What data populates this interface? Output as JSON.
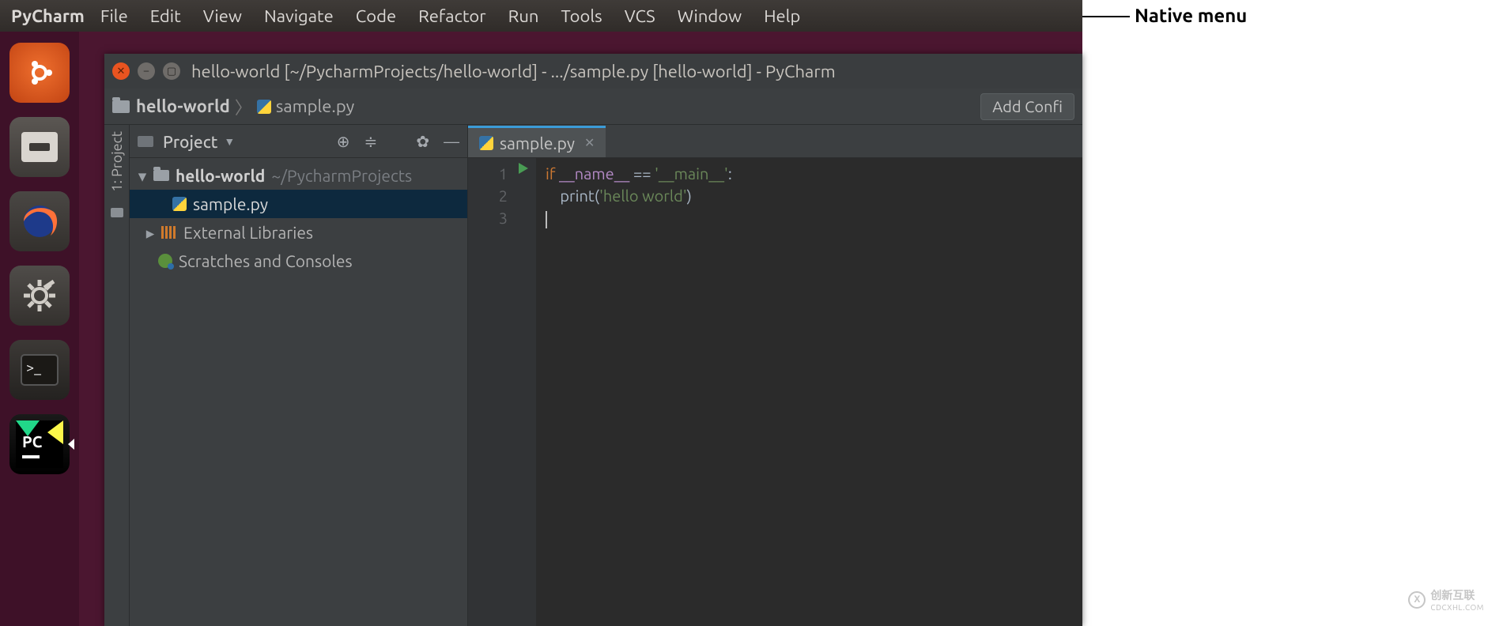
{
  "annotation": {
    "label": "Native menu"
  },
  "ubuntu_menu": {
    "app": "PyCharm",
    "items": [
      "File",
      "Edit",
      "View",
      "Navigate",
      "Code",
      "Refactor",
      "Run",
      "Tools",
      "VCS",
      "Window",
      "Help"
    ]
  },
  "launcher": {
    "items": [
      "ubuntu",
      "files",
      "firefox",
      "settings",
      "terminal",
      "pycharm"
    ]
  },
  "pycharm": {
    "title": "hello-world [~/PycharmProjects/hello-world] - .../sample.py [hello-world] - PyCharm",
    "breadcrumb": {
      "project": "hello-world",
      "file": "sample.py"
    },
    "toolbar": {
      "add_config": "Add Confi"
    },
    "project_pane": {
      "header": "Project",
      "vertical_label": "1: Project",
      "tree": {
        "root": {
          "name": "hello-world",
          "path": "~/PycharmProjects"
        },
        "file": "sample.py",
        "external": "External Libraries",
        "scratches": "Scratches and Consoles"
      }
    },
    "editor": {
      "tab": "sample.py",
      "lines": [
        "1",
        "2",
        "3"
      ],
      "code": {
        "l1": {
          "kw": "if",
          "dunder1": "__name__",
          "op": "==",
          "str": "'__main__'",
          "colon": ":"
        },
        "l2": {
          "indent": "    ",
          "fn": "print",
          "open": "(",
          "str": "'hello world'",
          "close": ")"
        }
      }
    }
  },
  "watermark": {
    "brand": "创新互联",
    "sub": "CDCXHL.COM"
  }
}
